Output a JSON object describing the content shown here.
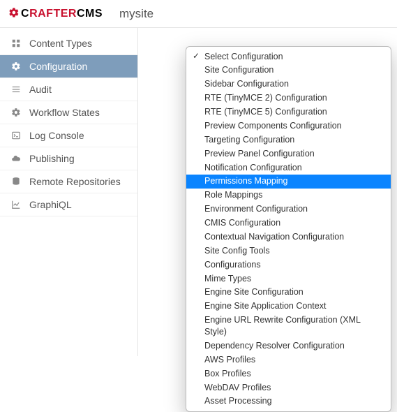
{
  "header": {
    "logo_black1": "C",
    "logo_red": "RAFTER",
    "logo_black2": "CMS",
    "sitename": "mysite"
  },
  "sidebar": {
    "items": [
      {
        "icon": "grid",
        "label": "Content Types",
        "active": false
      },
      {
        "icon": "gear",
        "label": "Configuration",
        "active": true
      },
      {
        "icon": "list",
        "label": "Audit",
        "active": false
      },
      {
        "icon": "gear",
        "label": "Workflow States",
        "active": false
      },
      {
        "icon": "terminal",
        "label": "Log Console",
        "active": false
      },
      {
        "icon": "cloud",
        "label": "Publishing",
        "active": false
      },
      {
        "icon": "database",
        "label": "Remote Repositories",
        "active": false
      },
      {
        "icon": "chart",
        "label": "GraphiQL",
        "active": false
      }
    ]
  },
  "dropdown": {
    "items": [
      {
        "label": "Select Configuration",
        "checked": true,
        "highlight": false
      },
      {
        "label": "Site Configuration",
        "checked": false,
        "highlight": false
      },
      {
        "label": "Sidebar Configuration",
        "checked": false,
        "highlight": false
      },
      {
        "label": "RTE (TinyMCE 2) Configuration",
        "checked": false,
        "highlight": false
      },
      {
        "label": "RTE (TinyMCE 5) Configuration",
        "checked": false,
        "highlight": false
      },
      {
        "label": "Preview Components Configuration",
        "checked": false,
        "highlight": false
      },
      {
        "label": "Targeting Configuration",
        "checked": false,
        "highlight": false
      },
      {
        "label": "Preview Panel Configuration",
        "checked": false,
        "highlight": false
      },
      {
        "label": "Notification Configuration",
        "checked": false,
        "highlight": false
      },
      {
        "label": "Permissions Mapping",
        "checked": false,
        "highlight": true
      },
      {
        "label": "Role Mappings",
        "checked": false,
        "highlight": false
      },
      {
        "label": "Environment Configuration",
        "checked": false,
        "highlight": false
      },
      {
        "label": "CMIS Configuration",
        "checked": false,
        "highlight": false
      },
      {
        "label": "Contextual Navigation Configuration",
        "checked": false,
        "highlight": false
      },
      {
        "label": "Site Config Tools",
        "checked": false,
        "highlight": false
      },
      {
        "label": "Configurations",
        "checked": false,
        "highlight": false
      },
      {
        "label": "Mime Types",
        "checked": false,
        "highlight": false
      },
      {
        "label": "Engine Site Configuration",
        "checked": false,
        "highlight": false
      },
      {
        "label": "Engine Site Application Context",
        "checked": false,
        "highlight": false
      },
      {
        "label": "Engine URL Rewrite Configuration (XML Style)",
        "checked": false,
        "highlight": false
      },
      {
        "label": "Dependency Resolver Configuration",
        "checked": false,
        "highlight": false
      },
      {
        "label": "AWS Profiles",
        "checked": false,
        "highlight": false
      },
      {
        "label": "Box Profiles",
        "checked": false,
        "highlight": false
      },
      {
        "label": "WebDAV Profiles",
        "checked": false,
        "highlight": false
      },
      {
        "label": "Asset Processing",
        "checked": false,
        "highlight": false
      }
    ]
  }
}
